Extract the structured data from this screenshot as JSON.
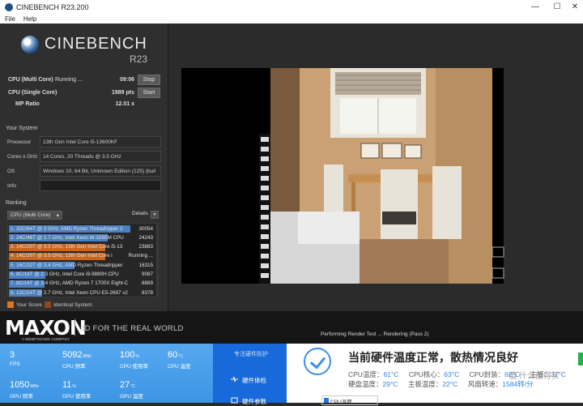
{
  "window": {
    "title": "CINEBENCH R23.200",
    "menu": [
      "File",
      "Help"
    ]
  },
  "logo": {
    "title": "CINEBENCH",
    "subtitle": "R23"
  },
  "tests": [
    {
      "label": "CPU (Multi Core)",
      "status": "Running ...",
      "value": "09:06",
      "button": "Stop"
    },
    {
      "label": "CPU (Single Core)",
      "status": "",
      "value": "1989 pts",
      "button": "Start"
    },
    {
      "label": "MP Ratio",
      "status": "",
      "value": "12.01 x",
      "button": ""
    }
  ],
  "your_system": {
    "title": "Your System",
    "rows": [
      {
        "key": "Processor",
        "value": "13th Gen Intel Core i5-13600KF"
      },
      {
        "key": "Cores x GHz",
        "value": "14 Cores, 20 Threads @ 3.5 GHz"
      },
      {
        "key": "OS",
        "value": "Windows 10, 64 Bit, Unknown Edition (125) (buil"
      },
      {
        "key": "Info",
        "value": ""
      }
    ]
  },
  "ranking": {
    "title": "Ranking",
    "select": "CPU (Multi Core)",
    "details": "Details",
    "items": [
      {
        "name": "1. 32C/64T @ 3 GHz, AMD Ryzen Threadripper 2",
        "score": "30054",
        "color": "#4a7fc1",
        "fill": 1.0
      },
      {
        "name": "2. 24C/48T @ 2.7 GHz, Intel Xeon W-3265M CPU",
        "score": "24243",
        "color": "#4a7fc1",
        "fill": 0.81
      },
      {
        "name": "3. 14C/20T @ 3.5 GHz, 13th Gen Intel Core i5-13",
        "score": "23883",
        "color": "#c8661f",
        "fill": 0.79
      },
      {
        "name": "4. 14C/20T @ 3.5 GHz, 13th Gen Intel Core i",
        "score": "Running ...",
        "color": "#c8661f",
        "fill": 0.79
      },
      {
        "name": "5. 16C/32T @ 3.4 GHz, AMD Ryzen Threadripper",
        "score": "16315",
        "color": "#4a7fc1",
        "fill": 0.54
      },
      {
        "name": "6. 8C/16T @ 2.3 GHz, Intel Core i9-9880H CPU",
        "score": "9087",
        "color": "#4a7fc1",
        "fill": 0.3
      },
      {
        "name": "7. 8C/16T @ 3.4 GHz, AMD Ryzen 7 1700X Eight-C",
        "score": "8889",
        "color": "#4a7fc1",
        "fill": 0.29
      },
      {
        "name": "8. 12C/24T @ 2.7 GHz, Intel Xeon CPU E5-2697 v2",
        "score": "8378",
        "color": "#4a7fc1",
        "fill": 0.27
      }
    ],
    "legend": [
      {
        "label": "Your Score",
        "color": "#e0761f"
      },
      {
        "label": "Identical System",
        "color": "#8c4a1c"
      }
    ]
  },
  "footer": {
    "brand": "MAXON",
    "brand_sub": "A NEMETSCHEK COMPANY",
    "tagline": "3D FOR THE REAL WORLD",
    "status": "Performing Render Test ... Rendering (Pass 2)"
  },
  "monitor": {
    "cells": [
      {
        "value": "3",
        "unit": "",
        "caption": "FPS"
      },
      {
        "value": "5092",
        "unit": "MHz",
        "caption": "CPU 频率"
      },
      {
        "value": "100",
        "unit": "%",
        "caption": "CPU 使用率"
      },
      {
        "value": "60",
        "unit": "°C",
        "caption": "CPU 温度"
      },
      {
        "value": "1050",
        "unit": "MHz",
        "caption": "GPU 频率"
      },
      {
        "value": "11",
        "unit": "%",
        "caption": "GPU 使用率"
      },
      {
        "value": "27",
        "unit": "°C",
        "caption": "GPU 温度"
      }
    ]
  },
  "side_nav": {
    "top": "专注硬件防护",
    "items": [
      "硬件体检",
      "硬件参数"
    ]
  },
  "status": {
    "headline": "当前硬件温度正常，散热情况良好",
    "temps_row1": [
      {
        "label": "CPU温度：",
        "value": "61°C"
      },
      {
        "label": "CPU核心：",
        "value": "63°C"
      },
      {
        "label": "CPU封装：",
        "value": "62°C"
      },
      {
        "label": "主板：",
        "value": "37°C"
      }
    ],
    "temps_row2": [
      {
        "label": "硬盘温度：",
        "value": "29°C"
      },
      {
        "label": "主板温度：",
        "value": "22°C"
      },
      {
        "label": "风扇转速：",
        "value": "1584转/分"
      }
    ],
    "pill": "CPU温度",
    "watermark": "值 什么值得买"
  },
  "colors": {
    "accent_blue": "#3a8ee8",
    "orange": "#e0761f",
    "monitor_blue": "#4a9fe9"
  }
}
